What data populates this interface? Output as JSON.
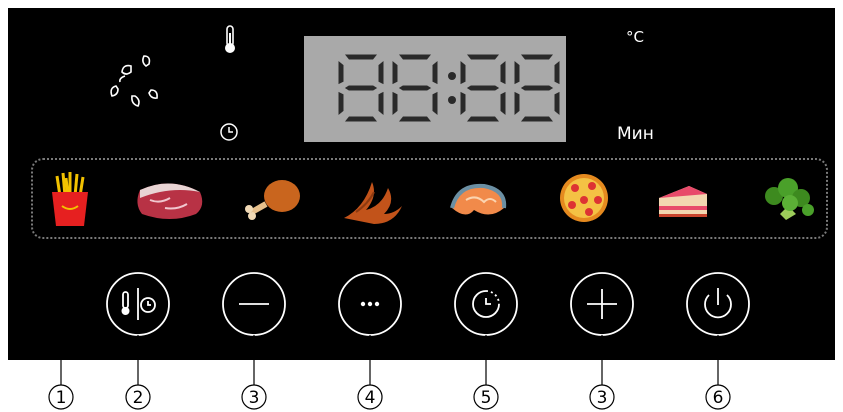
{
  "display": {
    "digits": "88:88",
    "temp_unit": "°C",
    "time_unit": "Мин"
  },
  "food_programs": [
    {
      "icon": "fries-icon"
    },
    {
      "icon": "steak-icon"
    },
    {
      "icon": "chicken-leg-icon"
    },
    {
      "icon": "chicken-wings-icon"
    },
    {
      "icon": "fish-steak-icon"
    },
    {
      "icon": "pizza-icon"
    },
    {
      "icon": "cake-icon"
    },
    {
      "icon": "broccoli-icon"
    }
  ],
  "buttons": [
    {
      "icon": "temp-time-toggle-icon",
      "callout": "2"
    },
    {
      "icon": "minus-icon",
      "callout": "3"
    },
    {
      "icon": "more-icon",
      "callout": "4"
    },
    {
      "icon": "delay-timer-icon",
      "callout": "5"
    },
    {
      "icon": "plus-icon",
      "callout": "3"
    },
    {
      "icon": "power-icon",
      "callout": "6"
    }
  ],
  "strip_callout": "1",
  "colors": {
    "panel": "#000000",
    "lcd_background": "#a9a9a9",
    "segment": "#2a2a2a",
    "button_ring": "#ffffff",
    "strip_border": "#7a7a7a"
  }
}
